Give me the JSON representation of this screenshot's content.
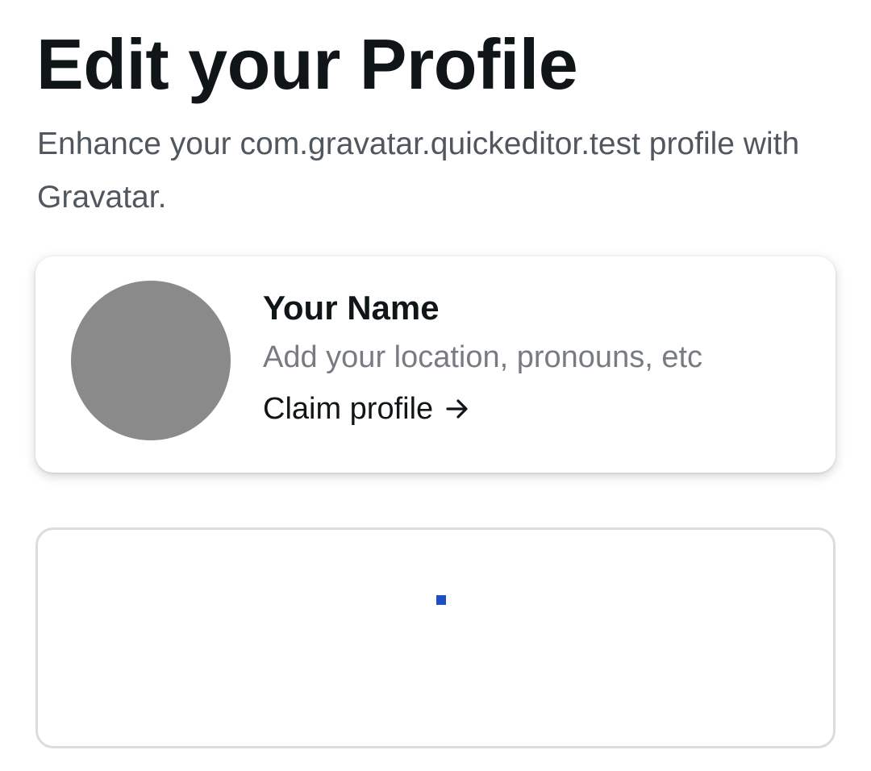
{
  "header": {
    "title": "Edit your Profile",
    "subtitle": "Enhance your com.gravatar.quickeditor.test profile with Gravatar."
  },
  "profile_card": {
    "name": "Your Name",
    "hint": "Add your location, pronouns, etc",
    "claim_label": "Claim profile",
    "claim_icon": "arrow-right-icon",
    "avatar_color": "#8a8a8a"
  },
  "loading_card": {
    "spinner_icon": "loading-spinner-icon",
    "spinner_color": "#1d4fc4"
  },
  "colors": {
    "title_text": "#101517",
    "subtitle_text": "#50575e",
    "hint_text": "#787c82",
    "card_border": "#dcdcde"
  }
}
